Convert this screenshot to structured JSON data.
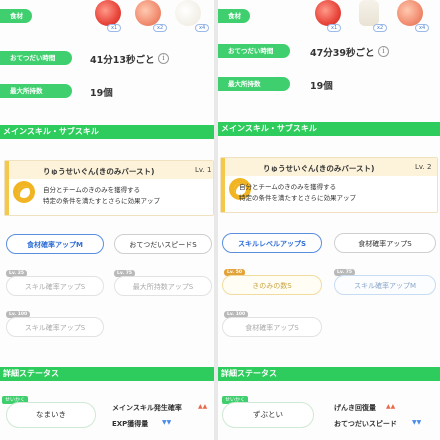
{
  "left": {
    "ingredients_label": "食材",
    "ingredients": [
      {
        "name": "tomato",
        "badge": "x1"
      },
      {
        "name": "tomato",
        "badge": "x2"
      },
      {
        "name": "egg",
        "badge": "x4"
      }
    ],
    "help_label": "おてつだい時間",
    "help_value": "41分13秒ごと",
    "carry_label": "最大所持数",
    "carry_value": "19個",
    "skills_header": "メインスキル・サブスキル",
    "main_skill_name": "りゅうせいぐん(きのみバースト)",
    "main_skill_lv": "Lv. 1",
    "main_skill_desc_1": "自分とチームのきのみを獲得する",
    "main_skill_desc_2": "特定の条件を満たすとさらに効果アップ",
    "sub_skills": [
      {
        "label": "食材確率アップM",
        "state": "active",
        "lv": ""
      },
      {
        "label": "おてつだいスピードS",
        "state": "normal",
        "lv": ""
      },
      {
        "label": "スキル確率アップS",
        "state": "locked",
        "lv": "Lv. 25"
      },
      {
        "label": "最大所持数アップS",
        "state": "locked",
        "lv": "Lv. 75"
      },
      {
        "label": "スキル確率アップS",
        "state": "locked",
        "lv": "Lv. 100"
      }
    ],
    "detail_header": "詳細ステータス",
    "nature_tag": "せいかく",
    "nature": "なまいき",
    "nature_up": "メインスキル発生確率",
    "nature_down": "EXP獲得量"
  },
  "right": {
    "ingredients_label": "食材",
    "ingredients": [
      {
        "name": "tomato",
        "badge": "x1"
      },
      {
        "name": "milk",
        "badge": "x2"
      },
      {
        "name": "tomato",
        "badge": "x4"
      }
    ],
    "help_label": "おてつだい時間",
    "help_value": "47分39秒ごと",
    "carry_label": "最大所持数",
    "carry_value": "19個",
    "skills_header": "メインスキル・サブスキル",
    "main_skill_name": "りゅうせいぐん(きのみバースト)",
    "main_skill_lv": "Lv. 2",
    "main_skill_desc_1": "自分とチームのきのみを獲得する",
    "main_skill_desc_2": "特定の条件を満たすとさらに効果アップ",
    "sub_skills": [
      {
        "label": "スキルレベルアップS",
        "state": "active",
        "lv": ""
      },
      {
        "label": "食材確率アップS",
        "state": "normal",
        "lv": ""
      },
      {
        "label": "きのみの数S",
        "state": "gold",
        "lv": "Lv. 50"
      },
      {
        "label": "スキル確率アップM",
        "state": "blue",
        "lv": "Lv. 75"
      },
      {
        "label": "食材確率アップS",
        "state": "locked",
        "lv": "Lv. 100"
      }
    ],
    "detail_header": "詳細ステータス",
    "nature_tag": "せいかく",
    "nature": "ずぶとい",
    "nature_up": "げんき回復量",
    "nature_down": "おてつだいスピード"
  },
  "colors": {
    "accent_green": "#2dcc5c",
    "skill_gold": "#f1b524",
    "active_blue": "#2f6ed6"
  }
}
